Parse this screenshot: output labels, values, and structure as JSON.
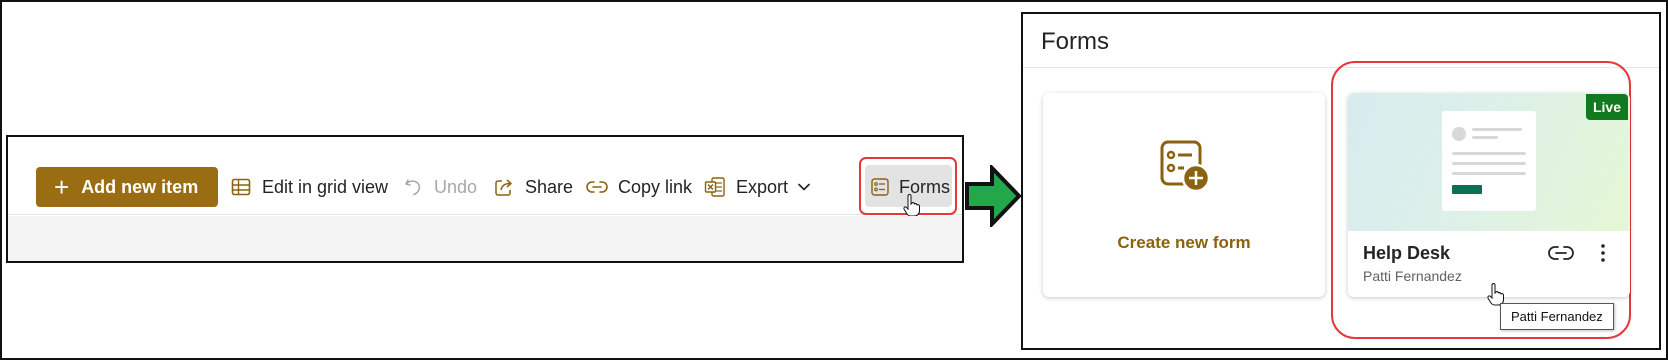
{
  "command_bar": {
    "add_new_item_label": "Add new item",
    "add_icon_glyph": "+",
    "items": [
      {
        "label": "Edit in grid view",
        "icon": "grid-icon",
        "disabled": false
      },
      {
        "label": "Undo",
        "icon": "undo-icon",
        "disabled": true
      },
      {
        "label": "Share",
        "icon": "share-icon",
        "disabled": false
      },
      {
        "label": "Copy link",
        "icon": "link-icon",
        "disabled": false
      },
      {
        "label": "Export",
        "icon": "excel-icon",
        "disabled": false,
        "has_dropdown": true
      },
      {
        "label": "Forms",
        "icon": "forms-icon",
        "disabled": false,
        "highlighted": true
      }
    ]
  },
  "forms_panel": {
    "title": "Forms",
    "create_card": {
      "label": "Create new form",
      "icon": "form-add-icon"
    },
    "form_card": {
      "badge": "Live",
      "name": "Help Desk",
      "owner": "Patti Fernandez",
      "actions": [
        "link-icon",
        "more-vertical-icon"
      ]
    },
    "tooltip": "Patti Fernandez"
  },
  "colors": {
    "accent": "#9a6d12",
    "accent_text": "#8a6210",
    "highlight": "#e5383b",
    "arrow_fill": "#22a84a",
    "live_badge": "#117a1f"
  }
}
